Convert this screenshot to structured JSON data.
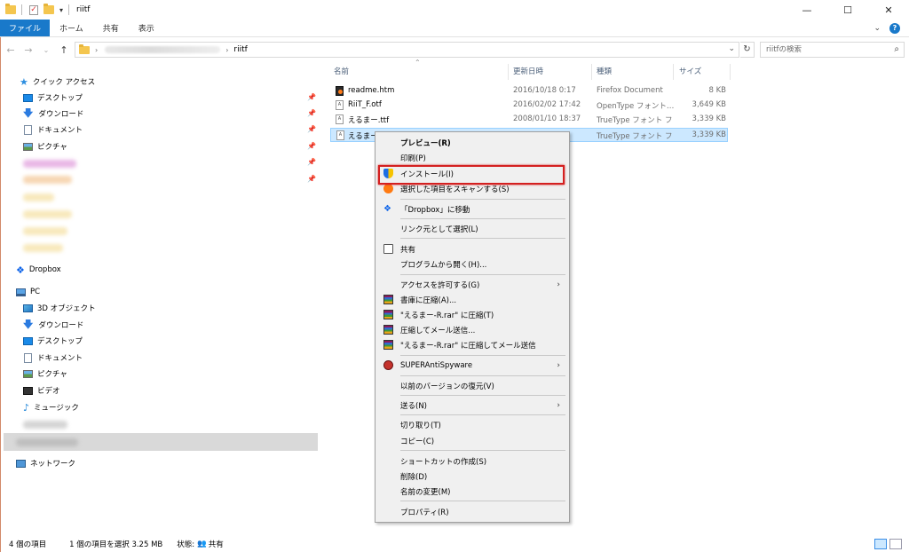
{
  "titlebar": {
    "title": "riitf",
    "controls": {
      "minimize": "—",
      "maximize": "☐",
      "close": "✕"
    }
  },
  "ribbon": {
    "tabs": [
      "ファイル",
      "ホーム",
      "共有",
      "表示"
    ],
    "expand": "⌄",
    "help": "?"
  },
  "address": {
    "current": "riitf",
    "search_placeholder": "riitfの検索"
  },
  "nav_pane": {
    "quick_access": "クイック アクセス",
    "quick_items": [
      "デスクトップ",
      "ダウンロード",
      "ドキュメント",
      "ピクチャ"
    ],
    "dropbox": "Dropbox",
    "pc": "PC",
    "pc_items": [
      "3D オブジェクト",
      "ダウンロード",
      "デスクトップ",
      "ドキュメント",
      "ピクチャ",
      "ビデオ",
      "ミュージック"
    ],
    "network": "ネットワーク"
  },
  "file_list": {
    "columns": {
      "name": "名前",
      "date": "更新日時",
      "type": "種類",
      "size": "サイズ"
    },
    "rows": [
      {
        "name": "readme.htm",
        "date": "2016/10/18 0:17",
        "type": "Firefox Document",
        "size": "8 KB"
      },
      {
        "name": "RiiT_F.otf",
        "date": "2016/02/02 17:42",
        "type": "OpenType フォント…",
        "size": "3,649 KB"
      },
      {
        "name": "えるまー.ttf",
        "date": "2008/01/10 18:37",
        "type": "TrueType フォント フ",
        "size": "3,339 KB"
      },
      {
        "name": "えるまー-R",
        "date": "",
        "type": "TrueType フォント フ",
        "size": "3,339 KB"
      }
    ]
  },
  "context_menu": {
    "preview": "プレビュー(R)",
    "print": "印刷(P)",
    "install": "インストール(I)",
    "scan": "選択した項目をスキャンする(S)",
    "dropbox_move": "「Dropbox」に移動",
    "link_source": "リンク元として選択(L)",
    "share": "共有",
    "open_with": "プログラムから開く(H)...",
    "grant_access": "アクセスを許可する(G)",
    "add_archive": "書庫に圧縮(A)...",
    "add_rar": "\"えるまー-R.rar\" に圧縮(T)",
    "compress_email": "圧縮してメール送信...",
    "compress_rar_email": "\"えるまー-R.rar\" に圧縮してメール送信",
    "superantispyware": "SUPERAntiSpyware",
    "restore_prev": "以前のバージョンの復元(V)",
    "send_to": "送る(N)",
    "cut": "切り取り(T)",
    "copy": "コピー(C)",
    "create_shortcut": "ショートカットの作成(S)",
    "delete": "削除(D)",
    "rename": "名前の変更(M)",
    "properties": "プロパティ(R)"
  },
  "status": {
    "item_count": "4 個の項目",
    "selected": "1 個の項目を選択  3.25 MB",
    "state": "状態:",
    "state_value": "共有"
  },
  "icons": {
    "back": "arrow-left-icon",
    "forward": "arrow-right-icon",
    "up": "arrow-up-icon",
    "refresh": "refresh-icon",
    "search": "search-icon",
    "pin": "pin-icon"
  },
  "colors": {
    "accent": "#1979ca",
    "selection": "#cce8ff",
    "highlight_box": "#d42020"
  }
}
